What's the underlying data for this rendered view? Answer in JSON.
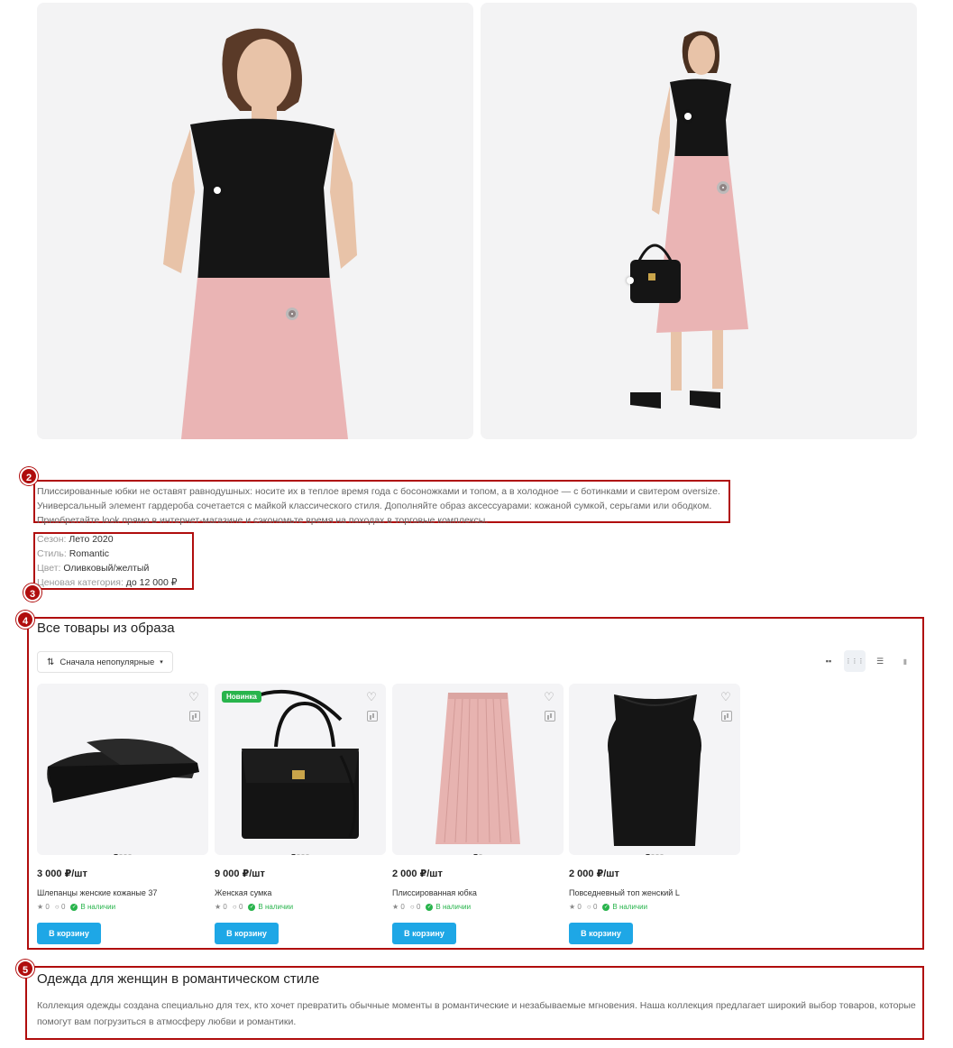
{
  "description": "Плиссированные юбки не оставят равнодушных: носите их в теплое время года с босоножками и топом, а в холодное — с ботинками и свитером oversize. Универсальный элемент гардероба сочетается с майкой классического стиля. Дополняйте образ аксессуарами: кожаной сумкой, серьгами или ободком. Приобретайте look прямо в интернет-магазине и сэкономьте время на походах в торговые комплексы.",
  "properties": [
    {
      "key": "Сезон",
      "value": "Лето 2020"
    },
    {
      "key": "Стиль",
      "value": "Romantic"
    },
    {
      "key": "Цвет",
      "value": "Оливковый/желтый"
    },
    {
      "key": "Ценовая категория",
      "value": "до 12 000 ₽"
    }
  ],
  "markers": [
    "2",
    "3",
    "4",
    "5"
  ],
  "products_section": {
    "title": "Все товары из образа",
    "sort_label": "Сначала непопулярные",
    "products": [
      {
        "price": "3 000 ₽/шт",
        "name": "Шлепанцы женские кожаные 37",
        "rating": "0",
        "reviews": "0",
        "stock": "В наличии",
        "buy": "В корзину",
        "badge": ""
      },
      {
        "price": "9 000 ₽/шт",
        "name": "Женская сумка",
        "rating": "0",
        "reviews": "0",
        "stock": "В наличии",
        "buy": "В корзину",
        "badge": "Новинка"
      },
      {
        "price": "2 000 ₽/шт",
        "name": "Плиссированная юбка",
        "rating": "0",
        "reviews": "0",
        "stock": "В наличии",
        "buy": "В корзину",
        "badge": ""
      },
      {
        "price": "2 000 ₽/шт",
        "name": "Повседневный топ женский L",
        "rating": "0",
        "reviews": "0",
        "stock": "В наличии",
        "buy": "В корзину",
        "badge": ""
      }
    ]
  },
  "collection": {
    "title": "Одежда для женщин в романтическом стиле",
    "text": "Коллекция одежды создана специально для тех, кто хочет превратить обычные моменты в романтические и незабываемые мгновения. Наша коллекция предлагает широкий выбор товаров, которые помогут вам погрузиться в атмосферу любви и романтики."
  },
  "colors": {
    "accent_red": "#b00d0d",
    "buy_button": "#1ea7e6",
    "new_badge": "#28b44c",
    "skirt_pink": "#eab4b4"
  }
}
